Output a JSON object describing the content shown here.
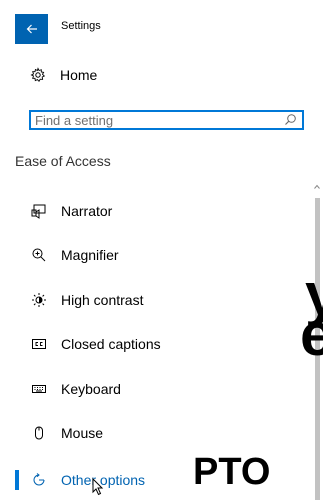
{
  "titlebar": {
    "title": "Settings",
    "back_icon": "arrow-left-icon"
  },
  "home": {
    "label": "Home",
    "icon": "gear-icon"
  },
  "search": {
    "placeholder": "Find a setting",
    "icon": "search-icon"
  },
  "section": {
    "header": "Ease of Access"
  },
  "nav": {
    "items": [
      {
        "label": "Narrator",
        "icon": "narrator-icon"
      },
      {
        "label": "Magnifier",
        "icon": "magnifier-icon"
      },
      {
        "label": "High contrast",
        "icon": "high-contrast-icon"
      },
      {
        "label": "Closed captions",
        "icon": "closed-captions-icon"
      },
      {
        "label": "Keyboard",
        "icon": "keyboard-icon"
      },
      {
        "label": "Mouse",
        "icon": "mouse-icon"
      },
      {
        "label": "Other options",
        "icon": "other-options-icon",
        "selected": true
      }
    ]
  },
  "background": {
    "glyph1": "y",
    "glyph2": "e",
    "word": "PTO"
  },
  "colors": {
    "accent": "#0078d7",
    "back_button": "#0063b1",
    "selected_text": "#0063b1"
  }
}
